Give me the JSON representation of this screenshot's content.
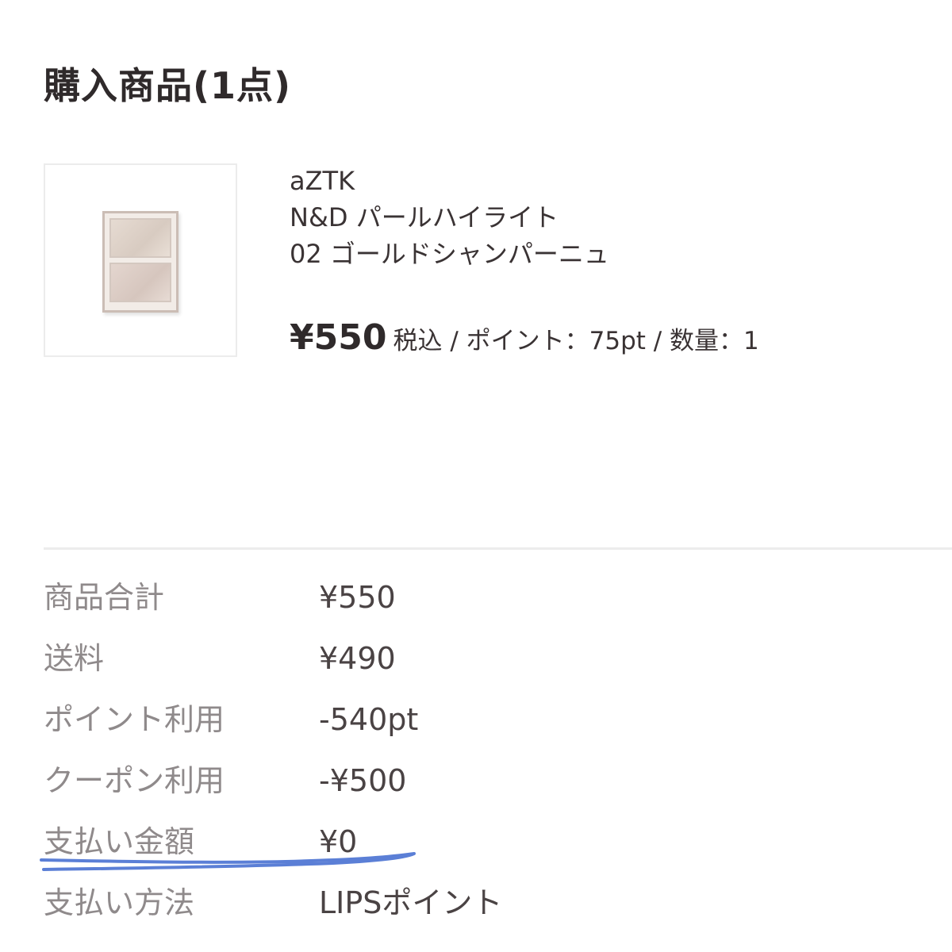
{
  "header": {
    "title": "購入商品(1点)"
  },
  "product": {
    "brand": "aZTK",
    "name": "N&D パールハイライト",
    "variant": "02 ゴールドシャンパーニュ",
    "price": "¥550",
    "price_detail": "税込 / ポイント：75pt / 数量：1"
  },
  "summary": {
    "rows": [
      {
        "label": "商品合計",
        "value": "¥550"
      },
      {
        "label": "送料",
        "value": "¥490"
      },
      {
        "label": "ポイント利用",
        "value": "-540pt"
      },
      {
        "label": "クーポン利用",
        "value": "-¥500"
      },
      {
        "label": "支払い金額",
        "value": "¥0"
      },
      {
        "label": "支払い方法",
        "value": "LIPSポイント"
      }
    ]
  },
  "colors": {
    "annotation_underline": "#5b7fd6",
    "label_text": "#8f8a8b",
    "value_text": "#4a4344",
    "divider": "#ececec"
  }
}
